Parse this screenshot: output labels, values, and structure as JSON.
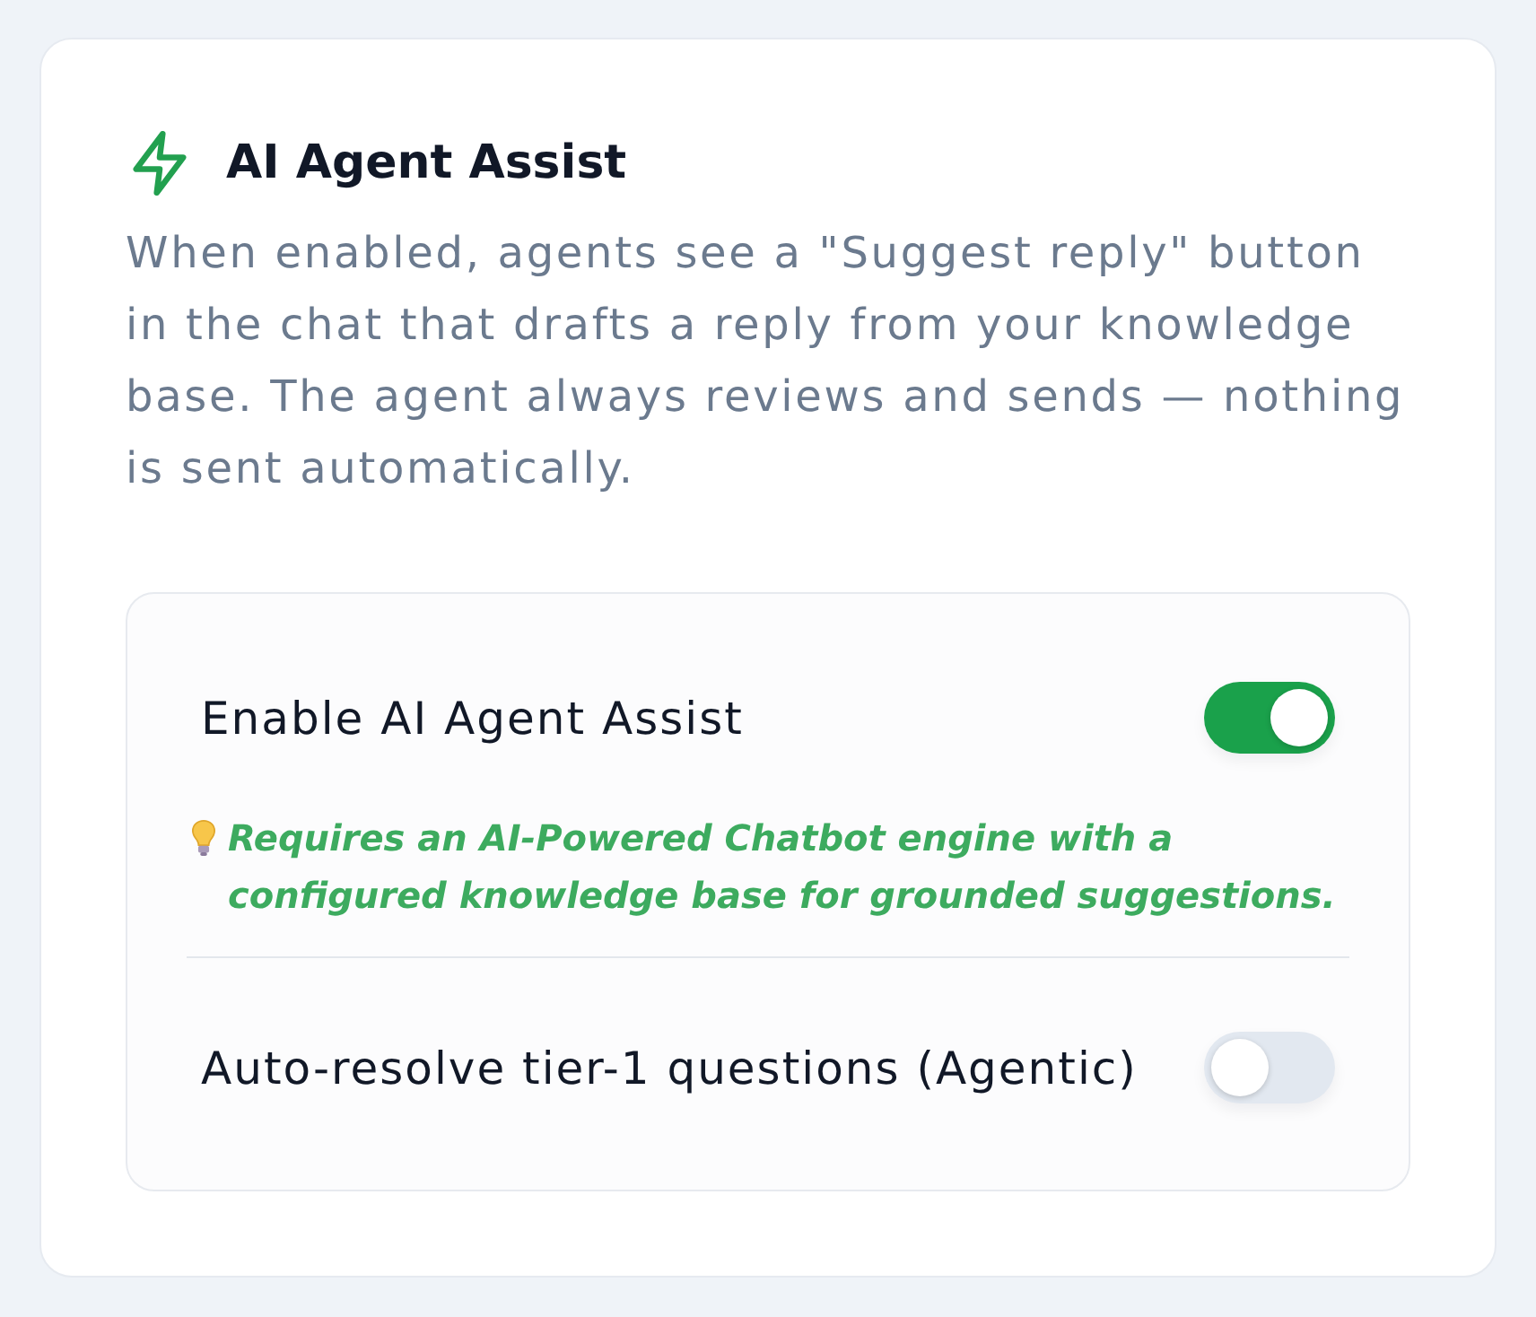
{
  "card": {
    "title": "AI Agent Assist",
    "description": "When enabled, agents see a \"Suggest reply\" button in the chat that drafts a reply from your knowledge base. The agent always reviews and sends — nothing is sent automatically."
  },
  "settings": [
    {
      "kind": "toggle",
      "label": "Enable AI Agent Assist",
      "on": true,
      "hint": "Requires an AI-Powered Chatbot engine with a configured knowledge base for grounded suggestions."
    },
    {
      "kind": "toggle",
      "label": "Auto-resolve tier-1 questions (Agentic)",
      "on": false
    }
  ]
}
